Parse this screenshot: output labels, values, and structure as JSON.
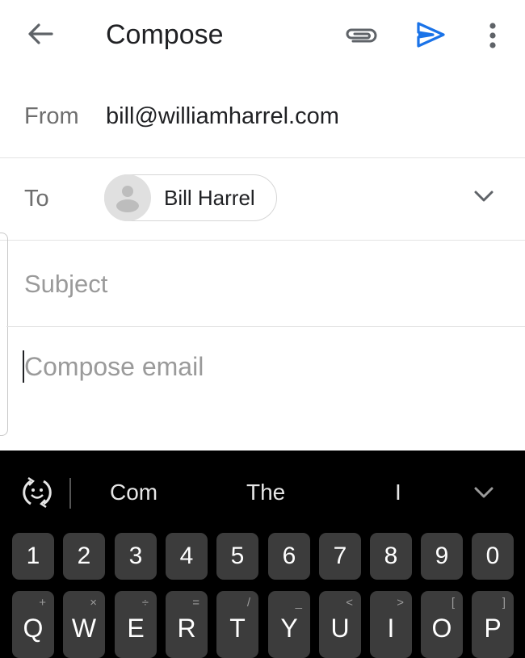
{
  "header": {
    "title": "Compose",
    "icons": [
      "back-arrow-icon",
      "attachment-icon",
      "send-icon",
      "more-vert-icon"
    ],
    "send_color": "#1a73e8"
  },
  "from": {
    "label": "From",
    "value": "bill@williamharrel.com"
  },
  "to": {
    "label": "To",
    "recipients": [
      {
        "name": "Bill Harrel"
      }
    ]
  },
  "subject": {
    "placeholder": "Subject",
    "value": ""
  },
  "body": {
    "placeholder": "Compose email",
    "value": ""
  },
  "keyboard": {
    "suggestions": [
      "Com",
      "The",
      "I"
    ],
    "number_row": [
      "1",
      "2",
      "3",
      "4",
      "5",
      "6",
      "7",
      "8",
      "9",
      "0"
    ],
    "letter_row": [
      {
        "key": "Q",
        "alt": "+"
      },
      {
        "key": "W",
        "alt": "×"
      },
      {
        "key": "E",
        "alt": "÷"
      },
      {
        "key": "R",
        "alt": "="
      },
      {
        "key": "T",
        "alt": "/"
      },
      {
        "key": "Y",
        "alt": "_"
      },
      {
        "key": "U",
        "alt": "<"
      },
      {
        "key": "I",
        "alt": ">"
      },
      {
        "key": "O",
        "alt": "["
      },
      {
        "key": "P",
        "alt": "]"
      }
    ]
  }
}
